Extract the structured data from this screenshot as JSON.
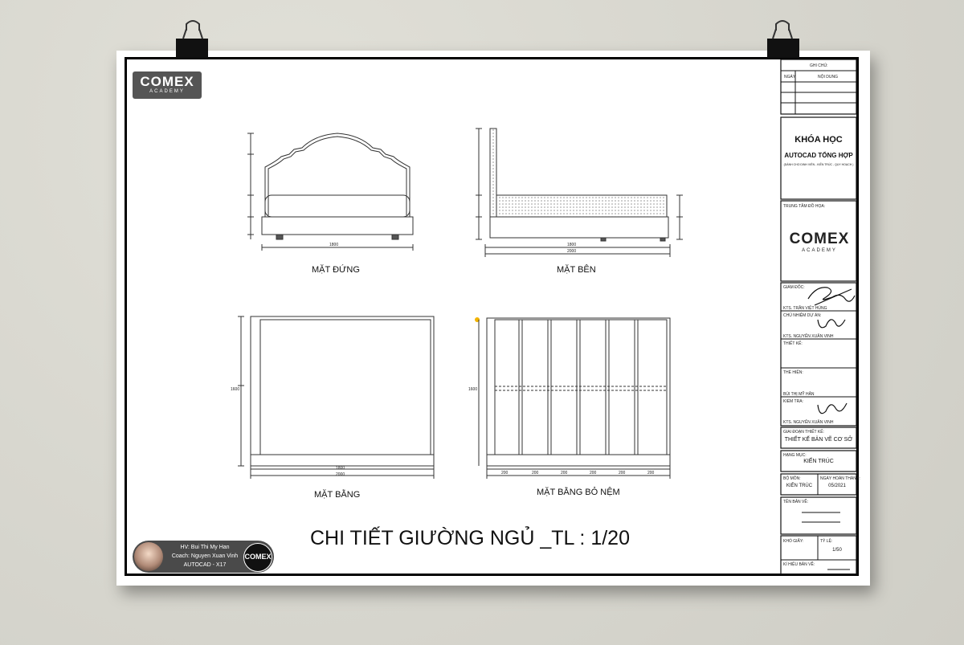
{
  "logo": {
    "brand": "COMEX",
    "sub": "ACADEMY"
  },
  "views": {
    "front": "MẶT ĐỨNG",
    "side": "MẶT BÊN",
    "plan": "MẶT BẰNG",
    "slat_plan": "MẶT BẰNG BỎ NỆM"
  },
  "sheet_title": "CHI TIẾT GIƯỜNG NGỦ _TL : 1/20",
  "dims": {
    "front_width": "1800",
    "side_inner": "1800",
    "side_total": "2000",
    "plan_inner": "1800",
    "plan_total": "2000",
    "plan_height": "1600",
    "slat_height": "1600",
    "slat_spans": [
      "200",
      "200",
      "200",
      "200",
      "200",
      "200"
    ]
  },
  "student": {
    "hv": "HV: Bui Thi My Han",
    "coach": "Coach: Nguyen Xuan Vinh",
    "course": "AUTOCAD - X17",
    "mini_brand": "COMEX"
  },
  "title_block": {
    "notes_header": "GHI CHÚ:",
    "col_date": "NGÀY",
    "col_content": "NỘI DUNG",
    "course_title": "KHÓA HỌC",
    "course_sub": "AUTOCAD TỔNG HỢP",
    "course_note": "(DÀNH CHO DINH VIÊN - KIẾN TRÚC - QUY HOẠCH )",
    "center_label": "TRUNG TÂM ĐỒ HỌA:",
    "brand": "COMEX",
    "brand_sub": "ACADEMY",
    "director_label": "GIÁM ĐỐC:",
    "director_name": "KTS. TRẦN VIỆT HÙNG",
    "chief_label": "CHỦ NHIỆM DỰ ÁN:",
    "chief_name": "KTS. NGUYỄN XUÂN VINH",
    "designer_label": "THIẾT KẾ:",
    "drafter_label": "THỂ HIỆN:",
    "drafter_name": "BÙI THỊ MỸ HÂN",
    "checker_label": "KIỂM TRA:",
    "checker_name": "KTS. NGUYỄN XUÂN VINH",
    "phase_label": "GIAI ĐOẠN THIẾT KẾ:",
    "phase_value": "THIẾT KẾ BẢN VẼ CƠ SỞ",
    "item_label": "HẠNG MỤC:",
    "item_value": "KIẾN TRÚC",
    "dept_label": "BỘ MÔN:",
    "dept_value": "KIẾN TRÚC",
    "date_label": "NGÀY HOÀN THÀNH:",
    "date_value": "05/2021",
    "sheet_name_label": "TÊN BẢN VẼ:",
    "paper_label": "KHỔ GIẤY:",
    "scale_label": "TỶ LỆ:",
    "scale_value": "1/50",
    "sheet_no_label": "KÍ HIỆU BẢN VẼ:"
  }
}
